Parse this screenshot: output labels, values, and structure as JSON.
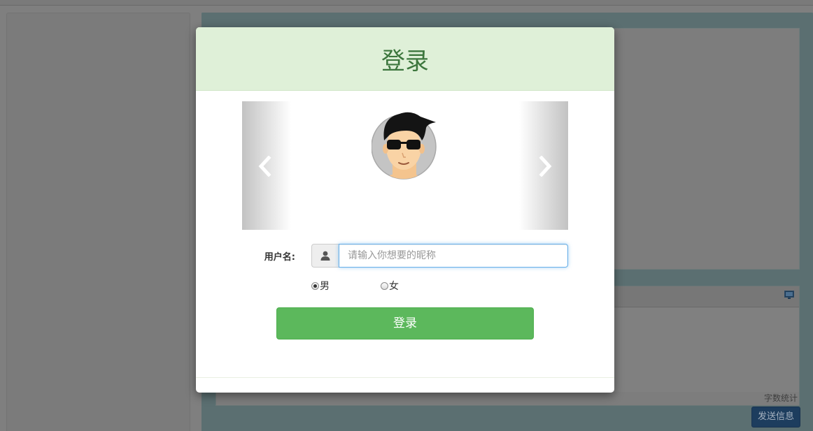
{
  "background": {
    "word_count_label": "字数统计",
    "send_button_label": "发送信息"
  },
  "login_modal": {
    "title": "登录",
    "carousel": {
      "prev_icon": "chevron-left-icon",
      "next_icon": "chevron-right-icon",
      "avatar": "avatar-man-sunglasses"
    },
    "username": {
      "label": "用户名:",
      "icon": "user-icon",
      "value": "",
      "placeholder": "请输入你想要的昵称"
    },
    "gender": {
      "options": [
        {
          "label": "男",
          "checked": true
        },
        {
          "label": "女",
          "checked": false
        }
      ]
    },
    "login_button_label": "登录"
  },
  "colors": {
    "header_bg": "#dff0d8",
    "header_text": "#3c763d",
    "primary_button": "#5cb85c",
    "focus_border": "#66afe9",
    "send_button": "#1d3d5e"
  }
}
